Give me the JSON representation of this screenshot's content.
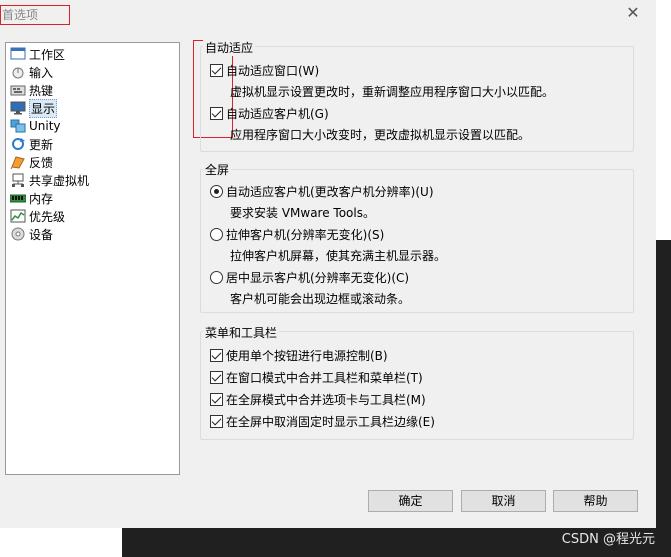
{
  "window": {
    "title": "首选项",
    "close_glyph": "✕"
  },
  "nav": {
    "items": [
      {
        "label": "工作区",
        "icon": "workspace-icon"
      },
      {
        "label": "输入",
        "icon": "input-icon"
      },
      {
        "label": "热键",
        "icon": "hotkeys-icon"
      },
      {
        "label": "显示",
        "icon": "display-icon",
        "selected": true
      },
      {
        "label": "Unity",
        "icon": "unity-icon"
      },
      {
        "label": "更新",
        "icon": "updates-icon"
      },
      {
        "label": "反馈",
        "icon": "feedback-icon"
      },
      {
        "label": "共享虚拟机",
        "icon": "shared-vm-icon"
      },
      {
        "label": "内存",
        "icon": "memory-icon"
      },
      {
        "label": "优先级",
        "icon": "priority-icon"
      },
      {
        "label": "设备",
        "icon": "devices-icon"
      }
    ]
  },
  "autofit": {
    "title": "自动适应",
    "window_label": "自动适应窗口(W)",
    "window_checked": true,
    "window_desc": "虚拟机显示设置更改时，重新调整应用程序窗口大小以匹配。",
    "guest_label": "自动适应客户机(G)",
    "guest_checked": true,
    "guest_desc": "应用程序窗口大小改变时，更改虚拟机显示设置以匹配。"
  },
  "fullscreen": {
    "title": "全屏",
    "opt1_label": "自动适应客户机(更改客户机分辨率)(U)",
    "opt1_desc": "要求安装 VMware Tools。",
    "opt2_label": "拉伸客户机(分辨率无变化)(S)",
    "opt2_desc": "拉伸客户机屏幕，使其充满主机显示器。",
    "opt3_label": "居中显示客户机(分辨率无变化)(C)",
    "opt3_desc": "客户机可能会出现边框或滚动条。",
    "selected": 1
  },
  "menus": {
    "title": "菜单和工具栏",
    "item1": "使用单个按钮进行电源控制(B)",
    "item2": "在窗口模式中合并工具栏和菜单栏(T)",
    "item3": "在全屏模式中合并选项卡与工具栏(M)",
    "item4": "在全屏中取消固定时显示工具栏边缘(E)"
  },
  "buttons": {
    "ok": "确定",
    "cancel": "取消",
    "help": "帮助"
  },
  "watermark": "CSDN @程光元",
  "colors": {
    "annotation_red": "#d9232a",
    "selection": "#dbe8f6"
  }
}
